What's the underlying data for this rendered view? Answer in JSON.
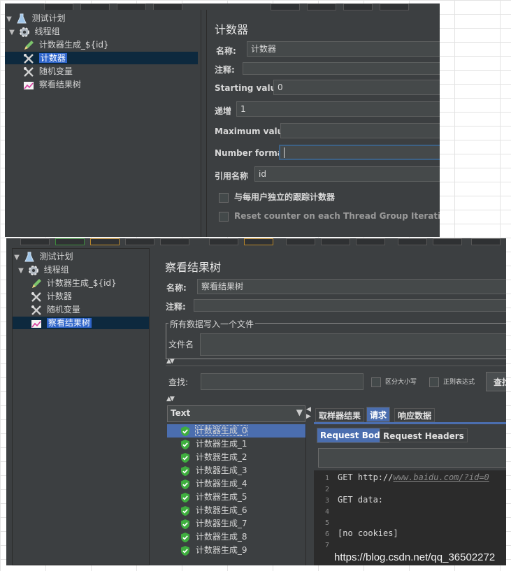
{
  "top_window": {
    "tree": [
      {
        "label": "测试计划",
        "icon": "flask-icon",
        "arrow": "▼"
      },
      {
        "label": "线程组",
        "icon": "gear-icon",
        "arrow": "▼"
      },
      {
        "label": "计数器生成_${id}",
        "icon": "pencil-icon"
      },
      {
        "label": "计数器",
        "icon": "tools-icon",
        "selected": true
      },
      {
        "label": "随机变量",
        "icon": "tools-icon"
      },
      {
        "label": "察看结果树",
        "icon": "chart-icon"
      }
    ],
    "title": "计数器",
    "name_label": "名称:",
    "name_value": "计数器",
    "comment_label": "注释:",
    "comment_value": "",
    "start_label": "Starting value",
    "start_value": "0",
    "incr_label": "递增",
    "incr_value": "1",
    "max_label": "Maximum value",
    "max_value": "",
    "format_label": "Number format",
    "format_value": "",
    "ref_label": "引用名称",
    "ref_value": "id",
    "check1": "与每用户独立的跟踪计数器",
    "check2": "Reset counter on each Thread Group Iteration"
  },
  "bottom_window": {
    "tree": [
      {
        "label": "测试计划",
        "icon": "flask-icon",
        "arrow": "▼"
      },
      {
        "label": "线程组",
        "icon": "gear-icon",
        "arrow": "▼"
      },
      {
        "label": "计数器生成_${id}",
        "icon": "pencil-icon"
      },
      {
        "label": "计数器",
        "icon": "tools-icon"
      },
      {
        "label": "随机变量",
        "icon": "tools-icon"
      },
      {
        "label": "察看结果树",
        "icon": "chart-icon",
        "selected": true
      }
    ],
    "title": "察看结果树",
    "name_label": "名称:",
    "name_value": "察看结果树",
    "comment_label": "注释:",
    "comment_value": "",
    "group_title": "所有数据写入一个文件",
    "file_label": "文件名",
    "file_value": "",
    "search_label": "查找:",
    "search_value": "",
    "case_label": "区分大小写",
    "regex_label": "正则表达式",
    "search_button": "查找",
    "renderer_value": "Text",
    "results": [
      "计数器生成_0",
      "计数器生成_1",
      "计数器生成_2",
      "计数器生成_3",
      "计数器生成_4",
      "计数器生成_5",
      "计数器生成_6",
      "计数器生成_7",
      "计数器生成_8",
      "计数器生成_9"
    ],
    "tabs": [
      "取样器结果",
      "请求",
      "响应数据"
    ],
    "active_tab": "请求",
    "subtabs": [
      "Request Body",
      "Request Headers"
    ],
    "code_lines": [
      {
        "n": "1",
        "prefix": "GET http://",
        "url": "www.baidu.com/?id=0"
      },
      {
        "n": "2",
        "prefix": "",
        "url": ""
      },
      {
        "n": "3",
        "prefix": "GET data:",
        "url": ""
      },
      {
        "n": "4",
        "prefix": "",
        "url": ""
      },
      {
        "n": "5",
        "prefix": "",
        "url": ""
      },
      {
        "n": "6",
        "prefix": "[no cookies]",
        "url": ""
      },
      {
        "n": "7",
        "prefix": "",
        "url": ""
      }
    ]
  },
  "watermark": "https://blog.csdn.net/qq_36502272",
  "colors": {
    "panel": "#3c3f41",
    "selection": "#2f65ca",
    "success": "#3fae3f"
  }
}
